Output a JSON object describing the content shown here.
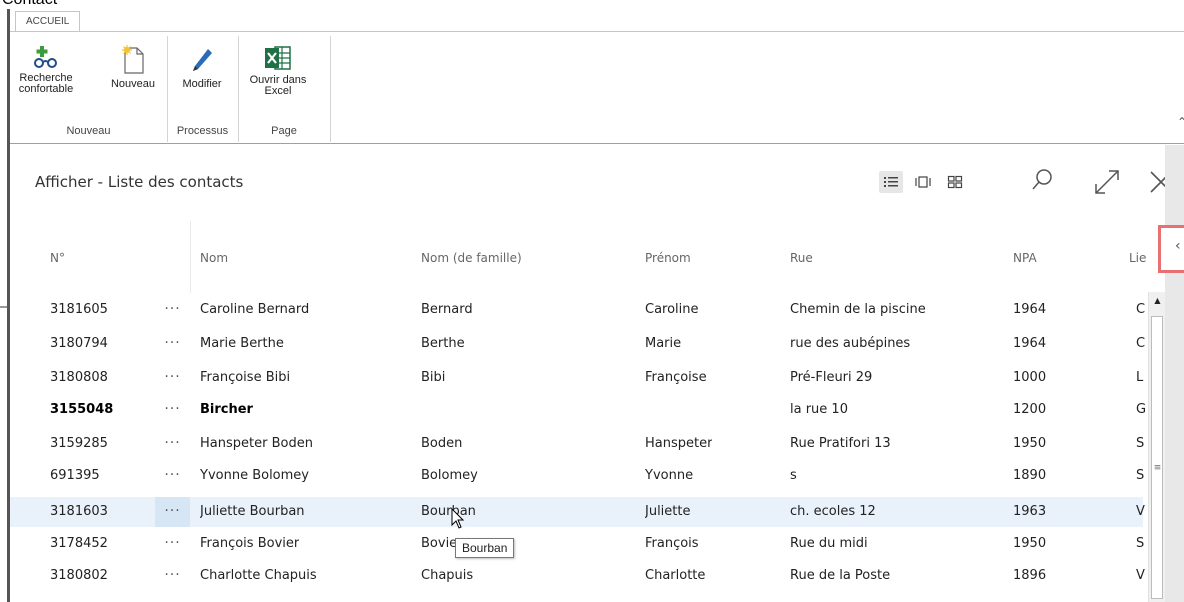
{
  "window": {
    "caption": "Contact"
  },
  "ribbon": {
    "tab": "ACCUEIL",
    "buttons": {
      "recherche": "Recherche confortable",
      "nouveau": "Nouveau",
      "modifier": "Modifier",
      "excel": "Ouvrir dans Excel"
    },
    "groups": {
      "nouveau": "Nouveau",
      "processus": "Processus",
      "page": "Page"
    }
  },
  "list": {
    "title": "Afficher - Liste des contacts",
    "columns": {
      "no": "N°",
      "nom": "Nom",
      "nom_famille": "Nom (de famille)",
      "prenom": "Prénom",
      "rue": "Rue",
      "npa": "NPA",
      "lieu": "Lieu"
    },
    "rows": [
      {
        "no": "3181605",
        "nom": "Caroline Bernard",
        "famille": "Bernard",
        "prenom": "Caroline",
        "rue": "Chemin de la piscine",
        "npa": "1964",
        "lieu": "C"
      },
      {
        "no": "3180794",
        "nom": "Marie Berthe",
        "famille": "Berthe",
        "prenom": "Marie",
        "rue": "rue des aubépines",
        "npa": "1964",
        "lieu": "C"
      },
      {
        "no": "3180808",
        "nom": "Françoise Bibi",
        "famille": "Bibi",
        "prenom": "Françoise",
        "rue": "Pré-Fleuri 29",
        "npa": "1000",
        "lieu": "L"
      },
      {
        "no": "3155048",
        "nom": "Bircher",
        "famille": "",
        "prenom": "",
        "rue": "la rue 10",
        "npa": "1200",
        "lieu": "G"
      },
      {
        "no": "3159285",
        "nom": "Hanspeter Boden",
        "famille": "Boden",
        "prenom": "Hanspeter",
        "rue": "Rue Pratifori 13",
        "npa": "1950",
        "lieu": "S"
      },
      {
        "no": "691395",
        "nom": "Yvonne Bolomey",
        "famille": "Bolomey",
        "prenom": "Yvonne",
        "rue": "s",
        "npa": "1890",
        "lieu": "S"
      },
      {
        "no": "3181603",
        "nom": "Juliette Bourban",
        "famille": "Bourban",
        "prenom": "Juliette",
        "rue": "ch. ecoles 12",
        "npa": "1963",
        "lieu": "V"
      },
      {
        "no": "3178452",
        "nom": "François Bovier",
        "famille": "Bovier",
        "prenom": "François",
        "rue": "Rue du midi",
        "npa": "1950",
        "lieu": "S"
      },
      {
        "no": "3180802",
        "nom": "Charlotte Chapuis",
        "famille": "Chapuis",
        "prenom": "Charlotte",
        "rue": "Rue de la Poste",
        "npa": "1896",
        "lieu": "V"
      }
    ],
    "row_actions": "···",
    "tooltip": "Bourban"
  },
  "colors": {
    "selected_row": "#e9f1fa",
    "excel_green": "#1e7145",
    "highlight_border": "#e87070"
  }
}
